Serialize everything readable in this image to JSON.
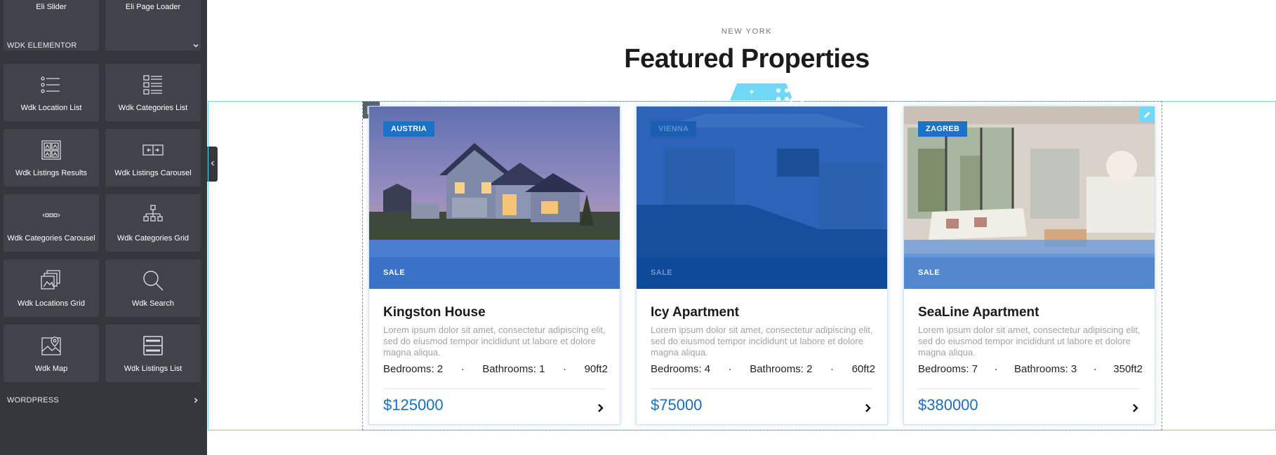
{
  "sidebar": {
    "top_widgets": [
      {
        "label": "Eli Slider"
      },
      {
        "label": "Eli Page Loader"
      }
    ],
    "section_title": "WDK ELEMENTOR",
    "widgets": [
      {
        "label": "Wdk Location List",
        "icon": "location-list-icon"
      },
      {
        "label": "Wdk Categories List",
        "icon": "categories-list-icon"
      },
      {
        "label": "Wdk Listings Results",
        "icon": "listings-results-icon"
      },
      {
        "label": "Wdk Listings Carousel",
        "icon": "listings-carousel-icon"
      },
      {
        "label": "Wdk Categories Carousel",
        "icon": "categories-carousel-icon"
      },
      {
        "label": "Wdk Categories Grid",
        "icon": "categories-grid-icon"
      },
      {
        "label": "Wdk Locations Grid",
        "icon": "locations-grid-icon"
      },
      {
        "label": "Wdk Search",
        "icon": "search-icon"
      },
      {
        "label": "Wdk Map",
        "icon": "map-icon"
      },
      {
        "label": "Wdk Listings List",
        "icon": "listings-list-icon"
      }
    ],
    "wordpress_title": "WORDPRESS"
  },
  "preview": {
    "subtitle": "NEW YORK",
    "title": "Featured Properties",
    "cards": [
      {
        "badge": "AUSTRIA",
        "sale": "SALE",
        "title": "Kingston House",
        "description": "Lorem ipsum dolor sit amet, consectetur adipiscing elit, sed do eiusmod tempor incididunt ut labore et dolore magna aliqua.",
        "bedrooms": "Bedrooms: 2",
        "bathrooms": "Bathrooms: 1",
        "area": "90ft2",
        "price": "$125000",
        "image": "house-exterior"
      },
      {
        "badge": "VIENNA",
        "sale": "SALE",
        "title": "Icy Apartment",
        "description": "Lorem ipsum dolor sit amet, consectetur adipiscing elit, sed do eiusmod tempor incididunt ut labore et dolore magna aliqua.",
        "bedrooms": "Bedrooms: 4",
        "bathrooms": "Bathrooms: 2",
        "area": "60ft2",
        "price": "$75000",
        "image": "kitchen-interior-blue-overlay"
      },
      {
        "badge": "ZAGREB",
        "sale": "SALE",
        "title": "SeaLine Apartment",
        "description": "Lorem ipsum dolor sit amet, consectetur adipiscing elit, sed do eiusmod tempor incididunt ut labore et dolore magna aliqua.",
        "bedrooms": "Bedrooms: 7",
        "bathrooms": "Bathrooms: 3",
        "area": "350ft2",
        "price": "$380000",
        "image": "living-room-interior"
      }
    ]
  },
  "colors": {
    "sidebar_bg": "#34383c",
    "widget_bg": "#404349",
    "accent_blue": "#1a72c9",
    "price_blue": "#1a6fc0",
    "editor_outline": "#71d7f7"
  }
}
